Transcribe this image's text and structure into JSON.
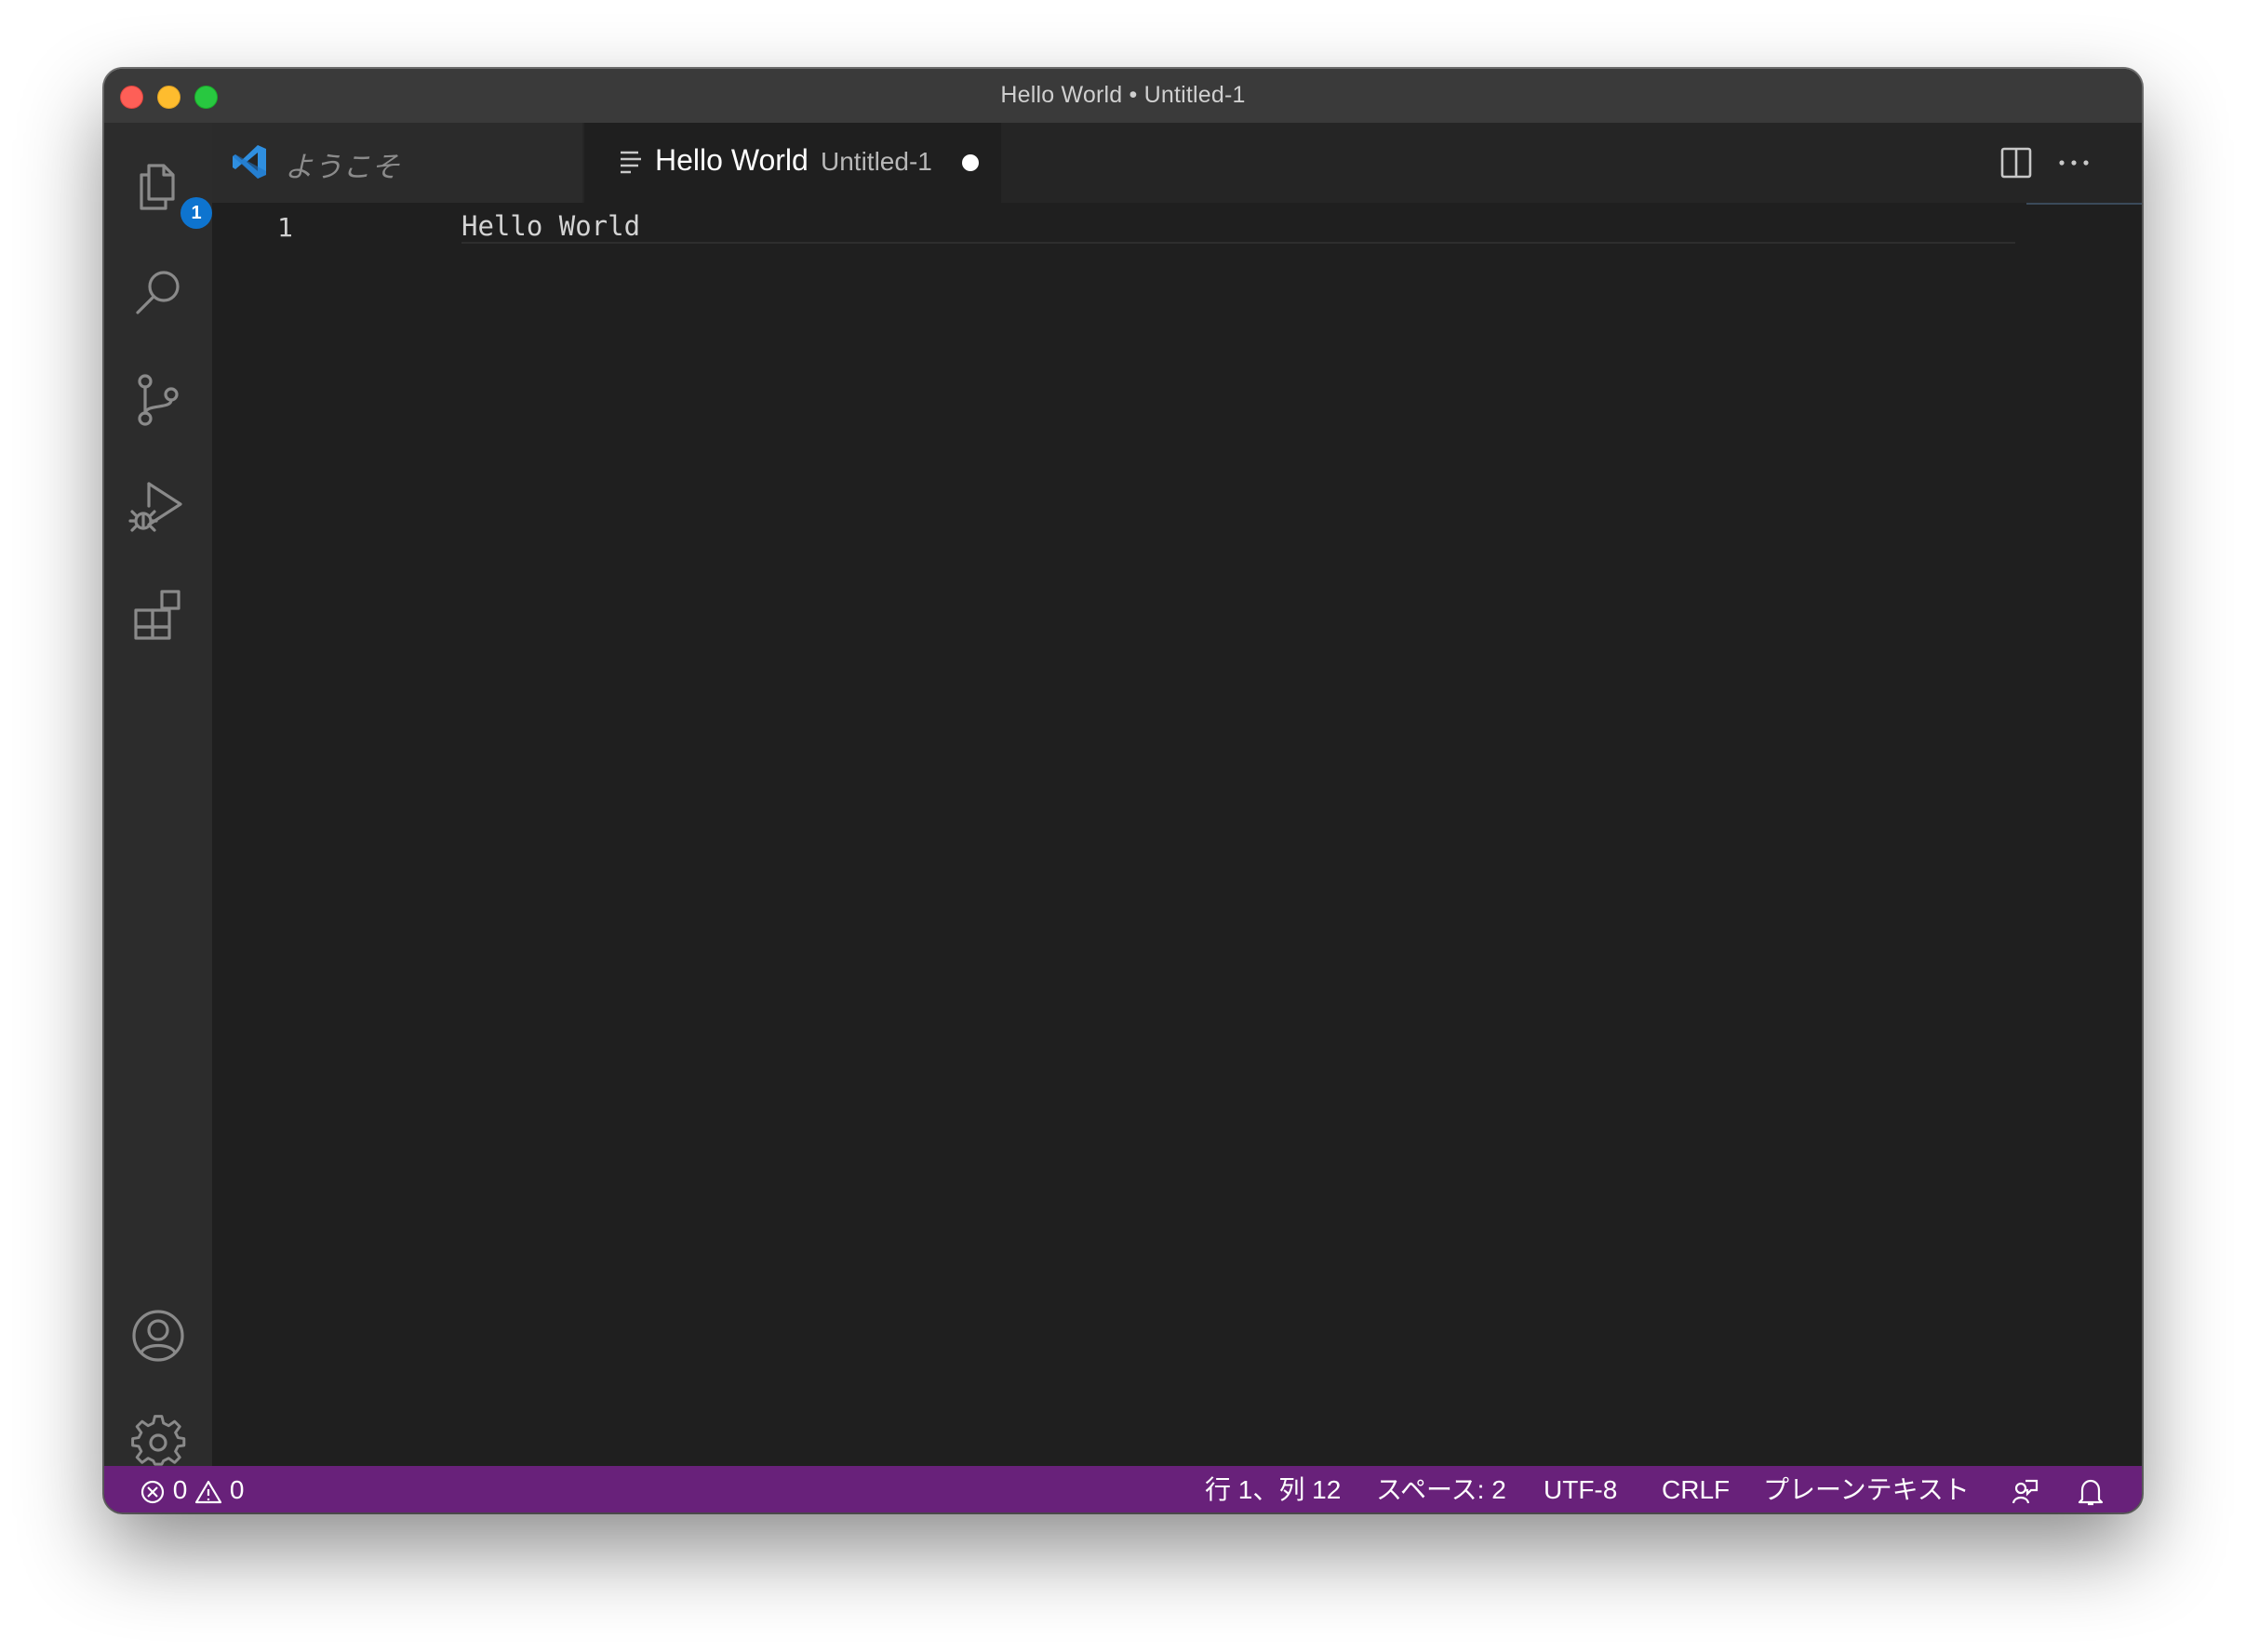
{
  "window": {
    "title": "Hello World • Untitled-1"
  },
  "activity_bar": {
    "explorer_badge": "1",
    "items": [
      "explorer-icon",
      "search-icon",
      "source-control-icon",
      "run-debug-icon",
      "extensions-icon"
    ],
    "bottom_items": [
      "account-icon",
      "settings-gear-icon"
    ]
  },
  "tabs": [
    {
      "label": "ようこそ",
      "icon": "vscode-logo-icon",
      "active": false
    },
    {
      "label": "Hello World",
      "description": "Untitled-1",
      "icon": "text-file-icon",
      "active": true,
      "dirty": true
    }
  ],
  "editor": {
    "lines": [
      {
        "number": "1",
        "text": "Hello World"
      }
    ]
  },
  "status_bar": {
    "errors": "0",
    "warnings": "0",
    "cursor_position": "行 1、列 12",
    "indentation": "スペース: 2",
    "encoding": "UTF-8",
    "line_ending": "CRLF",
    "language": "プレーンテキスト",
    "background_color": "#68217a"
  }
}
